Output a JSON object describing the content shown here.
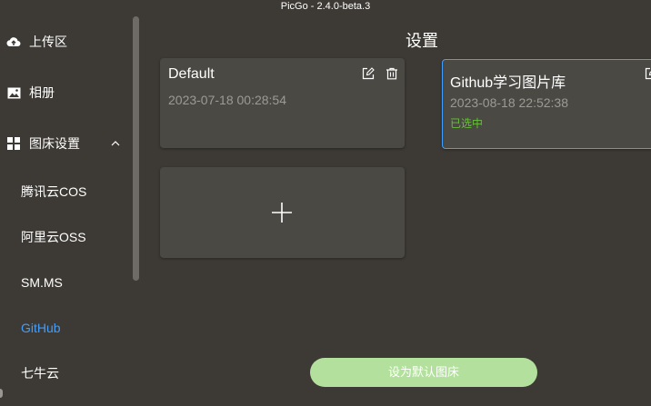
{
  "window": {
    "title": "PicGo - 2.4.0-beta.3"
  },
  "sidebar": {
    "items": [
      {
        "label": "上传区",
        "icon": "cloud-upload-icon"
      },
      {
        "label": "相册",
        "icon": "picture-icon"
      },
      {
        "label": "图床设置",
        "icon": "grid-icon",
        "expanded": true
      }
    ],
    "sub_items": [
      {
        "label": "腾讯云COS"
      },
      {
        "label": "阿里云OSS"
      },
      {
        "label": "SM.MS"
      },
      {
        "label": "GitHub",
        "active": true
      },
      {
        "label": "七牛云"
      }
    ]
  },
  "main": {
    "title": "设置",
    "configs": [
      {
        "name": "Default",
        "time": "2023-07-18 00:28:54",
        "selected": false
      },
      {
        "name": "Github学习图片库",
        "time": "2023-08-18 22:52:38",
        "status": "已选中",
        "selected": true
      }
    ],
    "add_icon": "plus-icon",
    "default_button": "设为默认图床"
  },
  "colors": {
    "background": "#3d3a35",
    "card": "#4b4944",
    "accent": "#409eff",
    "selected_status": "#67c23a",
    "button": "#b3e19d"
  }
}
